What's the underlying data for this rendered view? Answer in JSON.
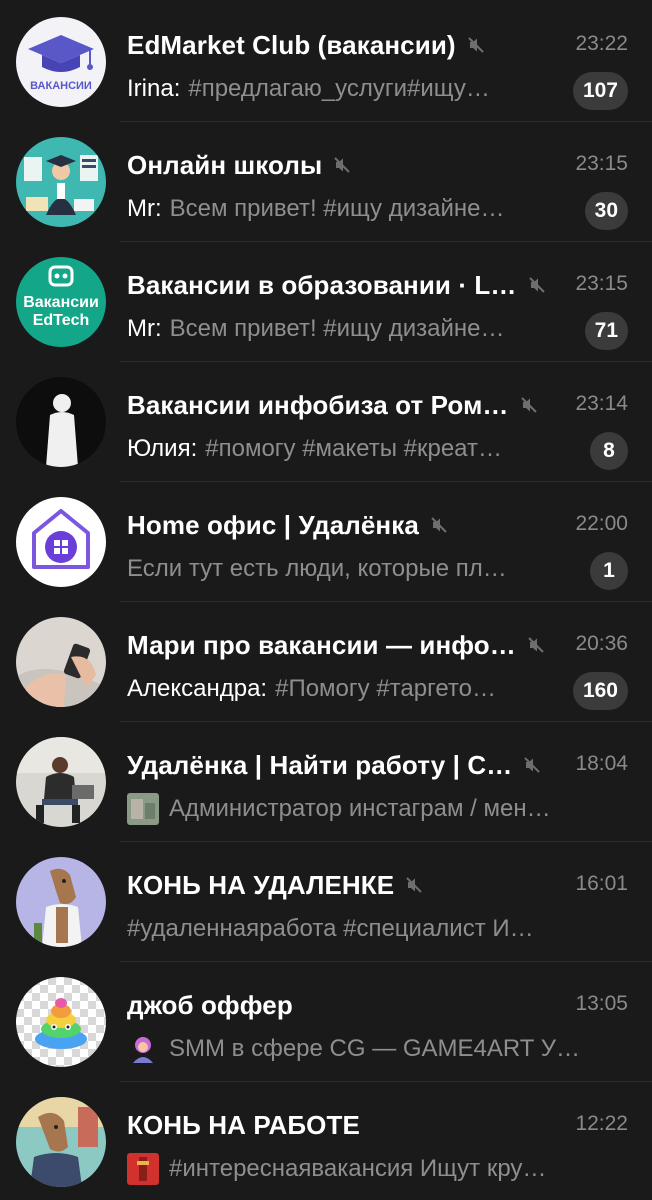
{
  "chats": [
    {
      "title": "EdMarket Club (вакансии)",
      "muted": true,
      "time": "23:22",
      "sender": "Irina:",
      "preview": "#предлагаю_услуги#ищу…",
      "unread": "107",
      "avatar_text": "ВАКАНСИИ"
    },
    {
      "title": "Онлайн школы",
      "muted": true,
      "time": "23:15",
      "sender": "Mr:",
      "preview": "Всем привет! #ищу дизайне…",
      "unread": "30"
    },
    {
      "title": "Вакансии в образовании · L…",
      "muted": true,
      "time": "23:15",
      "sender": "Mr:",
      "preview": "Всем привет! #ищу дизайне…",
      "unread": "71",
      "avatar_text_line1": "Вакансии",
      "avatar_text_line2": "EdTech"
    },
    {
      "title": "Вакансии инфобиза от Ром…",
      "muted": true,
      "time": "23:14",
      "sender": "Юлия:",
      "preview": "#помогу #макеты #креат…",
      "unread": "8"
    },
    {
      "title": "Home офис | Удалёнка",
      "muted": true,
      "time": "22:00",
      "sender": "",
      "preview": "Если тут есть люди, которые пл…",
      "unread": "1"
    },
    {
      "title": "Мари про вакансии — инфо…",
      "muted": true,
      "time": "20:36",
      "sender": "Александра:",
      "preview": "#Помогу #таргето…",
      "unread": "160"
    },
    {
      "title": "Удалёнка | Найти работу | С…",
      "muted": true,
      "time": "18:04",
      "sender": "",
      "preview": "Администратор инстаграм / мен…",
      "unread": ""
    },
    {
      "title": "КОНЬ НА УДАЛЕНКЕ",
      "muted": true,
      "time": "16:01",
      "sender": "",
      "preview": "#удаленнаяработа #специалист   И…",
      "unread": ""
    },
    {
      "title": "джоб оффер",
      "muted": false,
      "time": "13:05",
      "sender": "",
      "preview": "SMM в сфере CG — GAME4ART   У…",
      "unread": ""
    },
    {
      "title": "КОНЬ НА РАБОТЕ",
      "muted": false,
      "time": "12:22",
      "sender": "",
      "preview": "#интереснаявакансия  Ищут кру…",
      "unread": ""
    }
  ],
  "colors": {
    "background": "#1a1a1a",
    "title": "#ffffff",
    "preview": "#8e8e8e",
    "time": "#8a8a8a",
    "badge_muted": "#3b3b3b"
  }
}
